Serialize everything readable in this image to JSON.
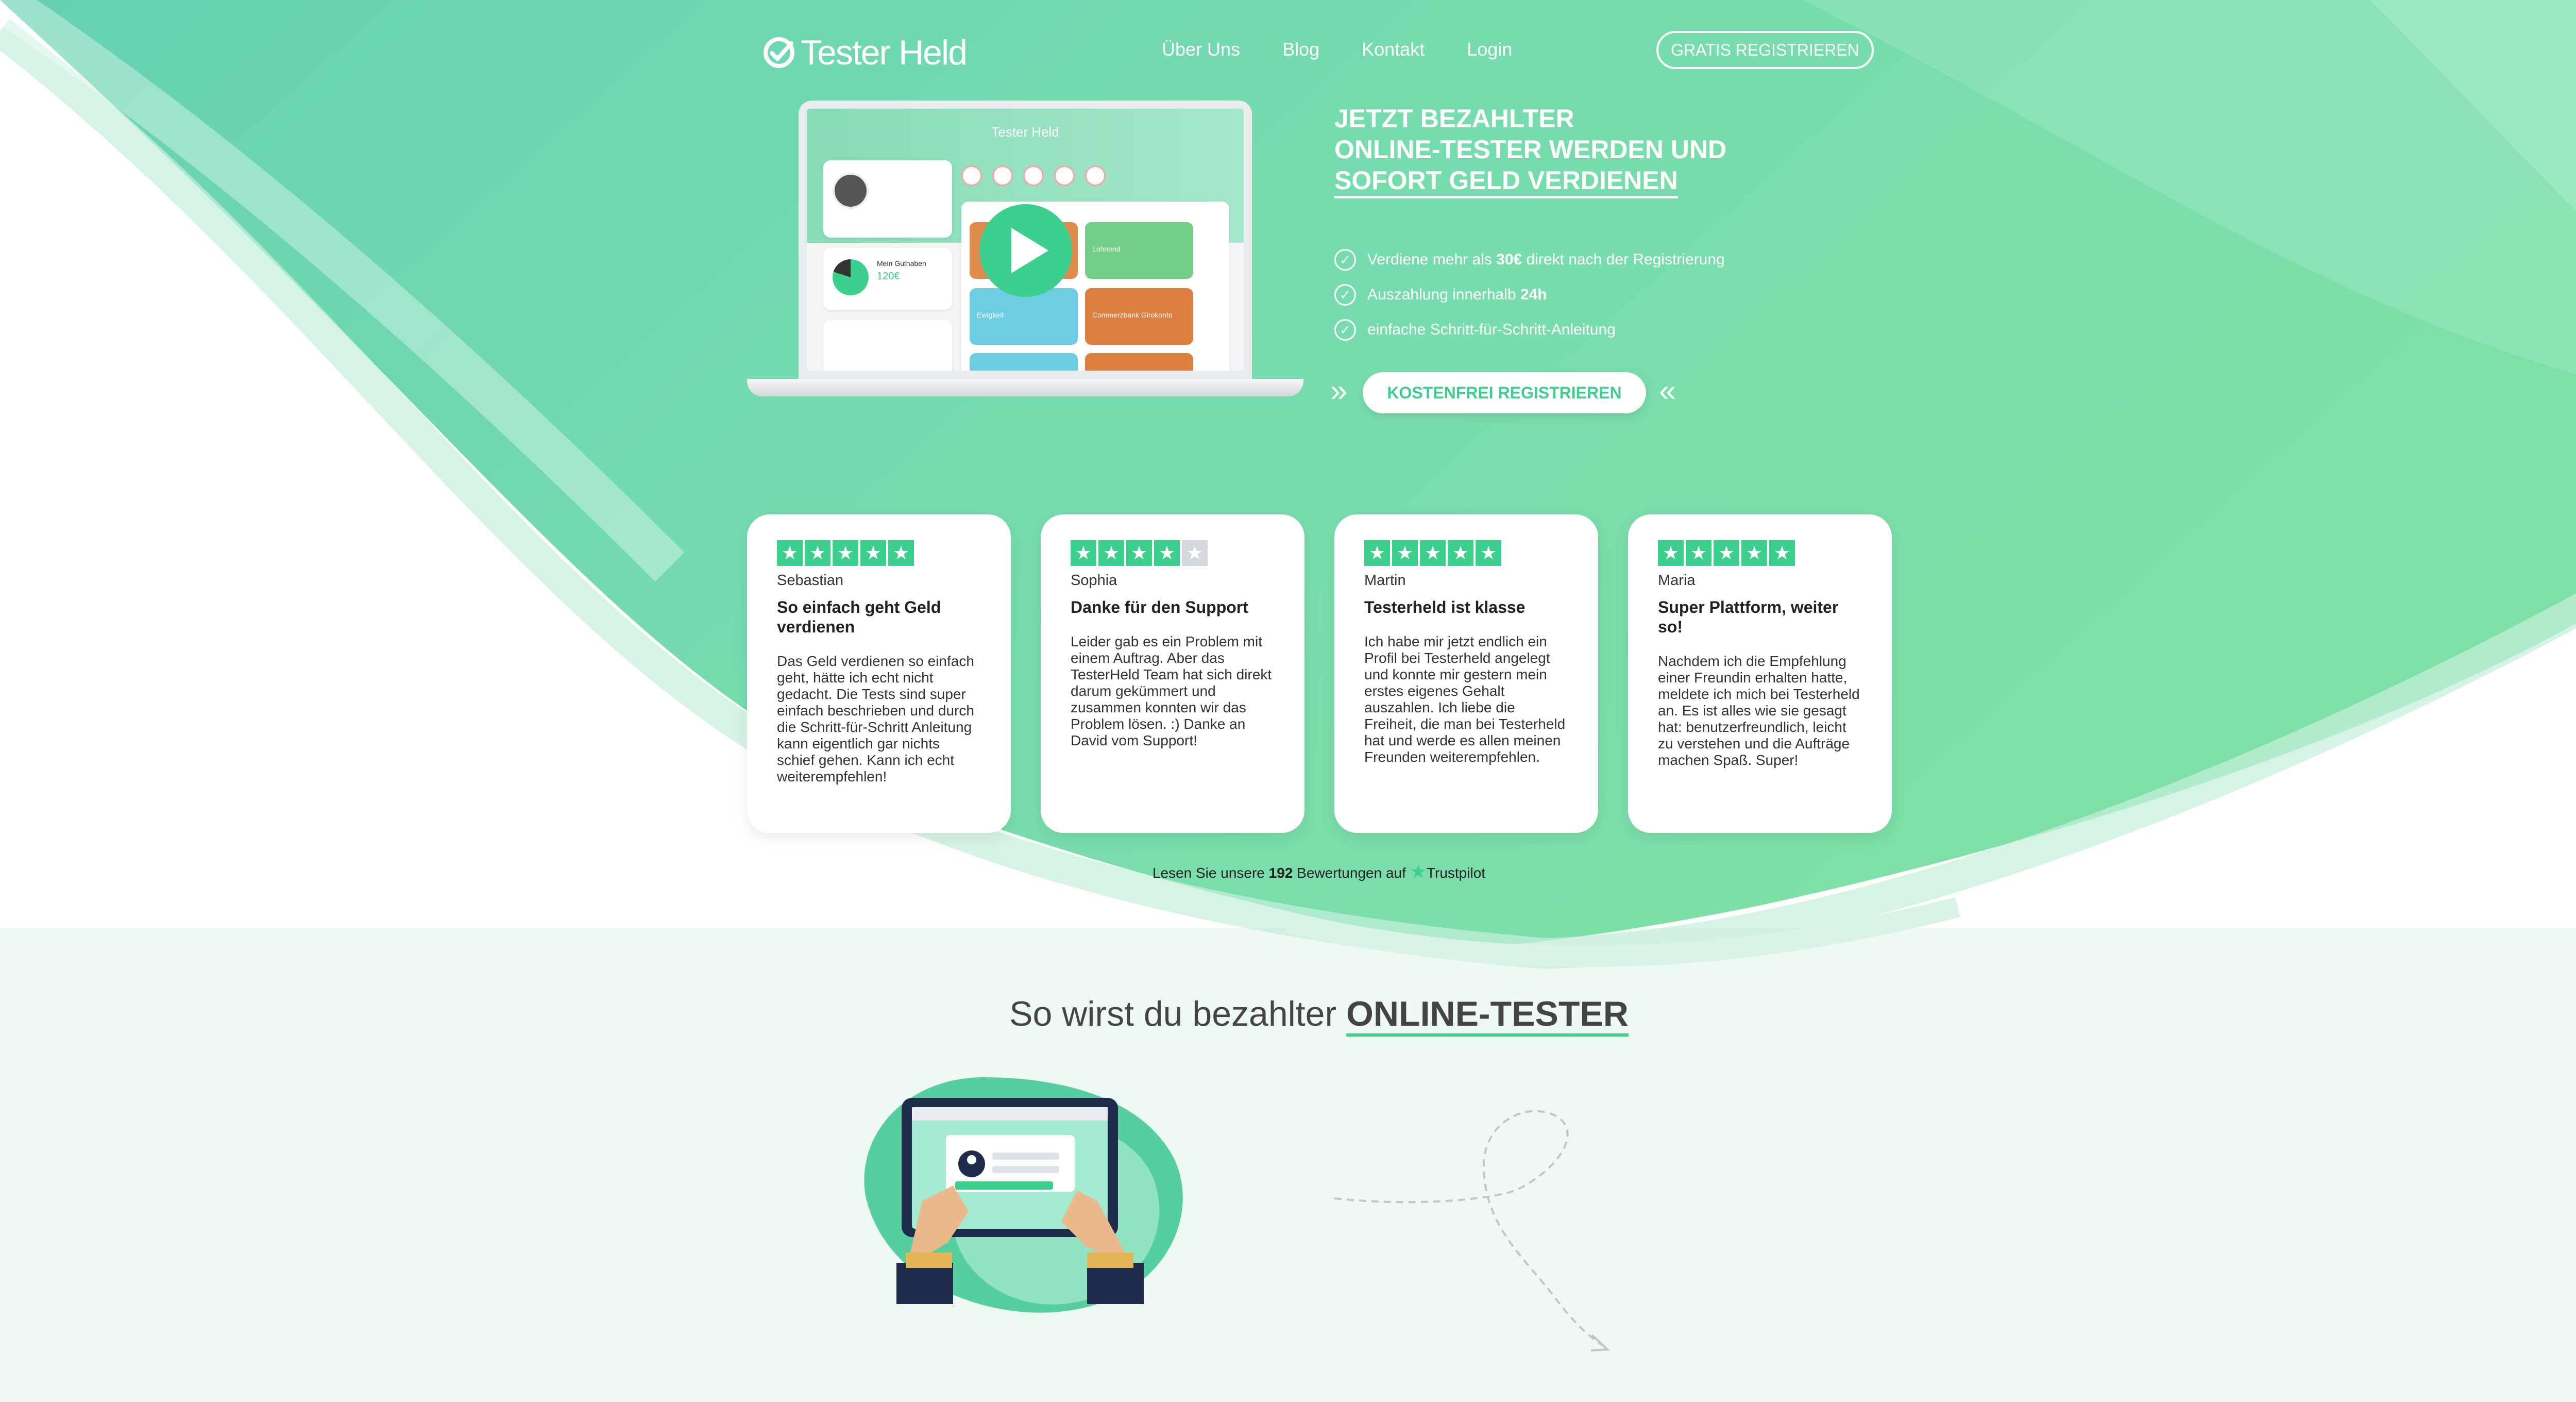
{
  "header": {
    "logo_text": "Tester Held",
    "nav": [
      "Über Uns",
      "Blog",
      "Kontakt",
      "Login"
    ],
    "register_button": "GRATIS REGISTRIEREN"
  },
  "hero": {
    "title_line1": "JETZT BEZAHLTER",
    "title_line2": "ONLINE-TESTER WERDEN UND",
    "title_line3": "SOFORT GELD VERDIENEN",
    "bullets": [
      {
        "pre": "Verdiene mehr als ",
        "bold": "30€",
        "post": " direkt nach der Registrierung"
      },
      {
        "pre": "Auszahlung innerhalb ",
        "bold": "24h",
        "post": ""
      },
      {
        "pre": "einfache Schritt-für-Schritt-Anleitung",
        "bold": "",
        "post": ""
      }
    ],
    "cta_button": "KOSTENFREI REGISTRIEREN",
    "screen_logo": "Tester Held",
    "screen_balance": "120€",
    "screen_labels": [
      "Mein Guthaben",
      "Lohnend",
      "Ewigkeit",
      "Commerzbank Girokonto"
    ]
  },
  "reviews": [
    {
      "name": "Sebastian",
      "rating": 5,
      "title": "So einfach geht Geld verdienen",
      "text": "Das Geld verdienen so einfach geht, hätte ich echt nicht gedacht. Die Tests sind super einfach beschrieben und durch die Schritt-für-Schritt Anleitung kann eigentlich gar nichts schief gehen. Kann ich echt weiterempfehlen!"
    },
    {
      "name": "Sophia",
      "rating": 4,
      "title": "Danke für den Support",
      "text": "Leider gab es ein Problem mit einem Auftrag. Aber das TesterHeld Team hat sich direkt darum gekümmert und zusammen konnten wir das Problem lösen. :) Danke an David vom Support!"
    },
    {
      "name": "Martin",
      "rating": 5,
      "title": "Testerheld ist klasse",
      "text": "Ich habe mir jetzt endlich ein Profil bei Testerheld angelegt und konnte mir gestern mein erstes eigenes Gehalt auszahlen. Ich liebe die Freiheit, die man bei Testerheld hat und werde es allen meinen Freunden weiterempfehlen."
    },
    {
      "name": "Maria",
      "rating": 5,
      "title": "Super Plattform, weiter so!",
      "text": "Nachdem ich die Empfehlung einer Freundin erhalten hatte, meldete ich mich bei Testerheld an. Es ist alles wie sie gesagt hat: benutzerfreundlich, leicht zu verstehen und die Aufträge machen Spaß. Super!"
    }
  ],
  "trustpilot": {
    "pre": "Lesen Sie unsere ",
    "count": "192",
    "post": " Bewertungen auf ",
    "brand": "Trustpilot"
  },
  "section2": {
    "title_pre": "So wirst du bezahlter ",
    "title_hl": "ONLINE-TESTER"
  },
  "colors": {
    "brand_green": "#3ccf8e",
    "hero_light": "#74d8b3",
    "star_off": "#d5d9dd",
    "section_bg": "#eef9f4"
  }
}
